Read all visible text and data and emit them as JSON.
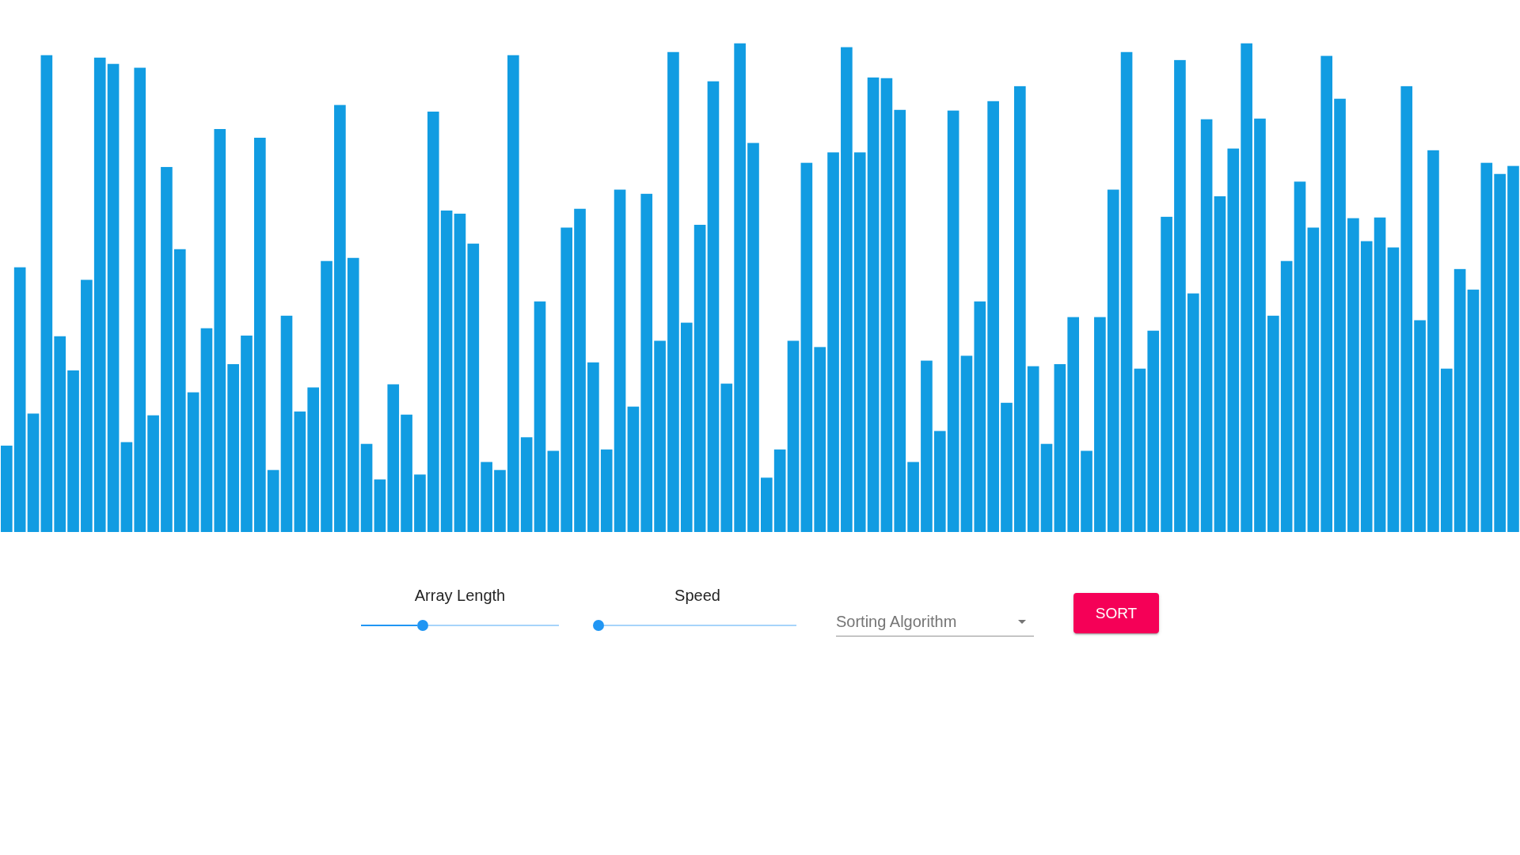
{
  "controls": {
    "sliders": [
      {
        "label": "Array Length",
        "level": 0.31
      },
      {
        "label": "Speed",
        "level": 0
      }
    ],
    "algorithm_select": {
      "placeholder": "Sorting Algorithm"
    },
    "sort_button": {
      "label": "SORT"
    }
  }
}
